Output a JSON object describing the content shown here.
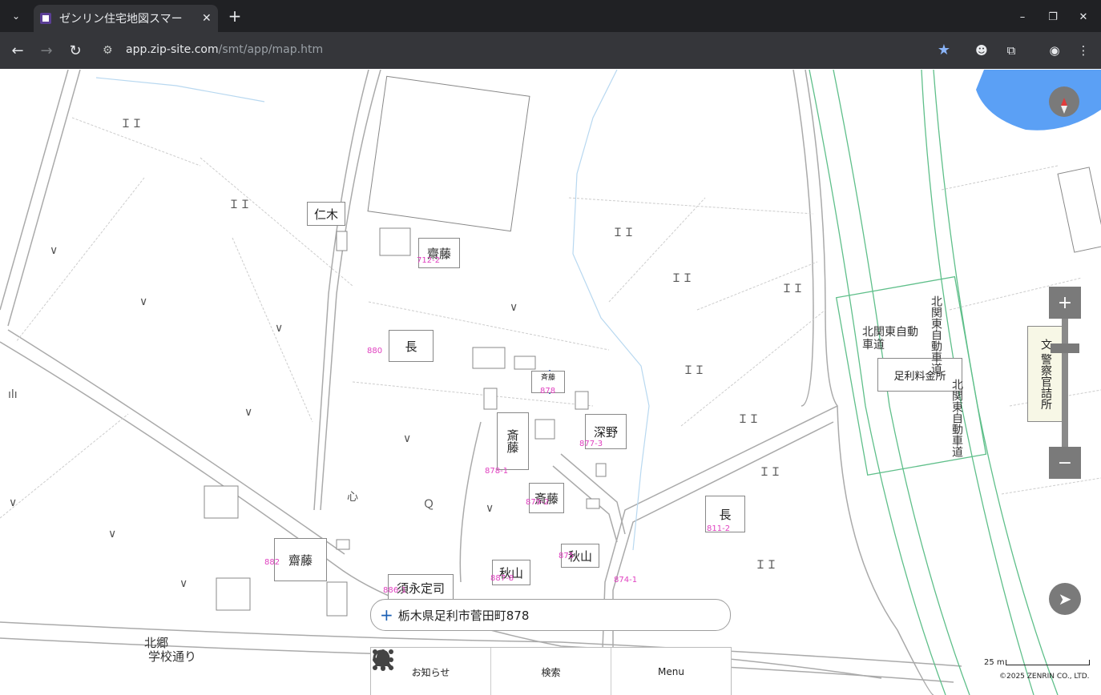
{
  "browser": {
    "tab_title": "ゼンリン住宅地図スマー",
    "url_host": "app.zip-site.com",
    "url_path": "/smt/app/map.htm"
  },
  "map": {
    "address": "栃木県足利市菅田町878",
    "labels": {
      "niki": "仁木",
      "saito1": "齋藤",
      "saito1_num": "712-2",
      "naga1": "長",
      "naga1_num": "880",
      "saito_small": "斉藤",
      "saito_small_num": "878",
      "saito2": "斎藤",
      "saito2_num": "878-1",
      "fukano": "深野",
      "fukano_num": "877-3",
      "saito3": "斎藤",
      "saito3_num": "879-2",
      "akiyama1": "秋山",
      "akiyama1_num": "887-8",
      "akiyama2": "秋山",
      "akiyama2_num": "875",
      "suenaga": "須永定司",
      "suenaga_num": "886-1",
      "saito4": "齋藤",
      "saito4_num": "882",
      "naga2": "長",
      "naga2_num": "811-2",
      "num_874": "874-1",
      "kitago": "北郷",
      "gakko": "学校通り",
      "toll": "足利料金所",
      "expressway": "北関東自動車道",
      "police": "文 警察官詰所"
    },
    "scale_text": "25 m",
    "copyright": "©2025 ZENRIN CO., LTD."
  },
  "bottom_nav": {
    "notice": "お知らせ",
    "search": "検索",
    "menu": "Menu"
  },
  "colors": {
    "water": "#5ba0f5",
    "parcel_number": "#e040c0",
    "control_gray": "#7a7a7a"
  }
}
